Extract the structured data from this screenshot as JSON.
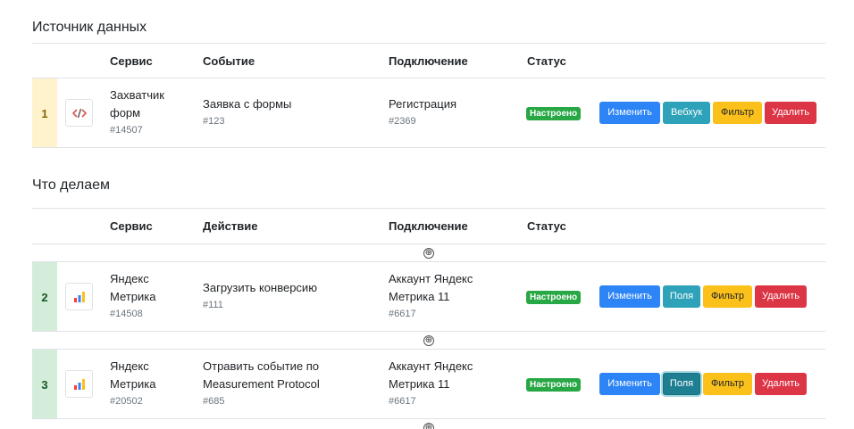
{
  "sections": {
    "source": {
      "title": "Источник данных",
      "headers": {
        "service": "Сервис",
        "event": "Событие",
        "connection": "Подключение",
        "status": "Статус"
      },
      "row": {
        "num": "1",
        "service_line1": "Захватчик",
        "service_line2": "форм",
        "service_id": "#14507",
        "event": "Заявка с формы",
        "event_id": "#123",
        "connection": "Регистрация",
        "connection_id": "#2369",
        "status": "Настроено",
        "buttons": {
          "edit": "Изменить",
          "webhook": "Вебхук",
          "filter": "Фильтр",
          "delete": "Удалить"
        }
      }
    },
    "actions": {
      "title": "Что делаем",
      "headers": {
        "service": "Сервис",
        "action": "Действие",
        "connection": "Подключение",
        "status": "Статус"
      },
      "add_icon": "⊕",
      "rows": [
        {
          "num": "2",
          "service_line1": "Яндекс",
          "service_line2": "Метрика",
          "service_id": "#14508",
          "action_line1": "Загрузить конверсию",
          "action_line2": "",
          "action_id": "#111",
          "connection_line1": "Аккаунт Яндекс",
          "connection_line2": "Метрика 11",
          "connection_id": "#6617",
          "status": "Настроено",
          "buttons": {
            "edit": "Изменить",
            "fields": "Поля",
            "filter": "Фильтр",
            "delete": "Удалить"
          }
        },
        {
          "num": "3",
          "service_line1": "Яндекс",
          "service_line2": "Метрика",
          "service_id": "#20502",
          "action_line1": "Отравить событие по",
          "action_line2": "Measurement Protocol",
          "action_id": "#685",
          "connection_line1": "Аккаунт Яндекс",
          "connection_line2": "Метрика 11",
          "connection_id": "#6617",
          "status": "Настроено",
          "buttons": {
            "edit": "Изменить",
            "fields": "Поля",
            "filter": "Фильтр",
            "delete": "Удалить"
          }
        }
      ]
    }
  },
  "icons": {
    "source_service": "code-icon",
    "metrika_service": "bar-chart-icon",
    "add": "plus-circle-icon"
  },
  "colors": {
    "primary": "#2d84f7",
    "info": "#2ea2b8",
    "warning": "#fbc11a",
    "danger": "#dc3545",
    "success": "#28a745"
  }
}
